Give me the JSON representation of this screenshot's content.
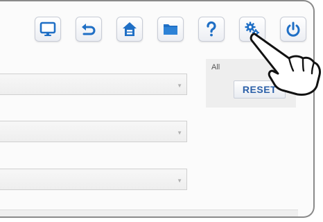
{
  "toolbar": {
    "buttons": [
      {
        "name": "monitor",
        "icon": "monitor-icon"
      },
      {
        "name": "back",
        "icon": "undo-arrow-icon"
      },
      {
        "name": "home",
        "icon": "home-icon"
      },
      {
        "name": "folder",
        "icon": "folder-icon"
      },
      {
        "name": "help",
        "icon": "question-mark-icon"
      },
      {
        "name": "settings",
        "icon": "gear-icon"
      },
      {
        "name": "power",
        "icon": "power-icon"
      }
    ]
  },
  "panel": {
    "label": "All",
    "reset_label": "RESET"
  },
  "colors": {
    "icon_blue": "#1f6fc5",
    "reset_text": "#2a5fa8"
  },
  "pointer": {
    "icon": "pointing-hand-icon"
  }
}
